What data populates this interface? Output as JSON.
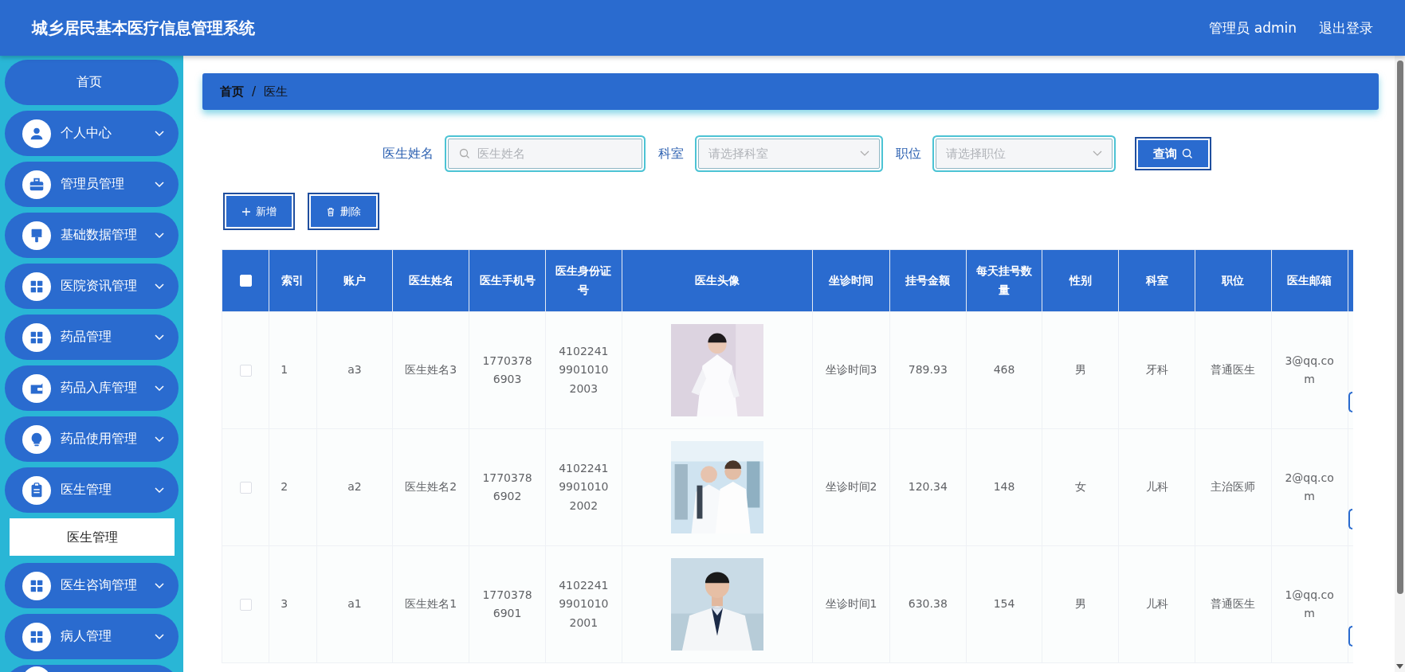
{
  "header": {
    "title": "城乡居民基本医疗信息管理系统",
    "user": "管理员 admin",
    "logout": "退出登录"
  },
  "sidebar": {
    "items": [
      {
        "label": "首页"
      },
      {
        "label": "个人中心"
      },
      {
        "label": "管理员管理"
      },
      {
        "label": "基础数据管理"
      },
      {
        "label": "医院资讯管理"
      },
      {
        "label": "药品管理"
      },
      {
        "label": "药品入库管理"
      },
      {
        "label": "药品使用管理"
      },
      {
        "label": "医生管理",
        "children": [
          {
            "label": "医生管理",
            "selected": true
          }
        ]
      },
      {
        "label": "医生咨询管理"
      },
      {
        "label": "病人管理"
      }
    ]
  },
  "breadcrumb": {
    "separator": "/",
    "items": [
      "首页",
      "医生"
    ]
  },
  "search": {
    "fields": [
      {
        "kind": "text",
        "label": "医生姓名",
        "placeholder": "医生姓名"
      },
      {
        "kind": "select",
        "label": "科室",
        "placeholder": "请选择科室"
      },
      {
        "kind": "select",
        "label": "职位",
        "placeholder": "请选择职位"
      }
    ],
    "button": "查询"
  },
  "actions": [
    {
      "kind": "add",
      "label": "新增"
    },
    {
      "kind": "delete",
      "label": "删除"
    }
  ],
  "table": {
    "all_checked": false,
    "columns": [
      {
        "label": "索引"
      },
      {
        "label": "账户"
      },
      {
        "label": "医生姓名"
      },
      {
        "label": "医生手机号"
      },
      {
        "label": "医生身份证号"
      },
      {
        "label": "医生头像"
      },
      {
        "label": "坐诊时间"
      },
      {
        "label": "挂号金额"
      },
      {
        "label": "每天挂号数量"
      },
      {
        "label": "性别"
      },
      {
        "label": "科室"
      },
      {
        "label": "职位"
      },
      {
        "label": "医生邮箱"
      }
    ],
    "rows": [
      {
        "checked": false,
        "cells": [
          "1",
          "a3",
          "医生姓名3",
          "17703786903",
          "410224199010102003",
          {
            "kind": "picture"
          },
          "坐诊时间3",
          "789.93",
          "468",
          "男",
          "牙科",
          "普通医生",
          "3@qq.com"
        ]
      },
      {
        "checked": false,
        "cells": [
          "2",
          "a2",
          "医生姓名2",
          "17703786902",
          "410224199010102002",
          {
            "kind": "picture"
          },
          "坐诊时间2",
          "120.34",
          "148",
          "女",
          "儿科",
          "主治医师",
          "2@qq.com"
        ]
      },
      {
        "checked": false,
        "cells": [
          "3",
          "a1",
          "医生姓名1",
          "17703786901",
          "410224199010102001",
          {
            "kind": "picture"
          },
          "坐诊时间1",
          "630.38",
          "154",
          "男",
          "儿科",
          "普通医生",
          "1@qq.com"
        ]
      }
    ]
  }
}
